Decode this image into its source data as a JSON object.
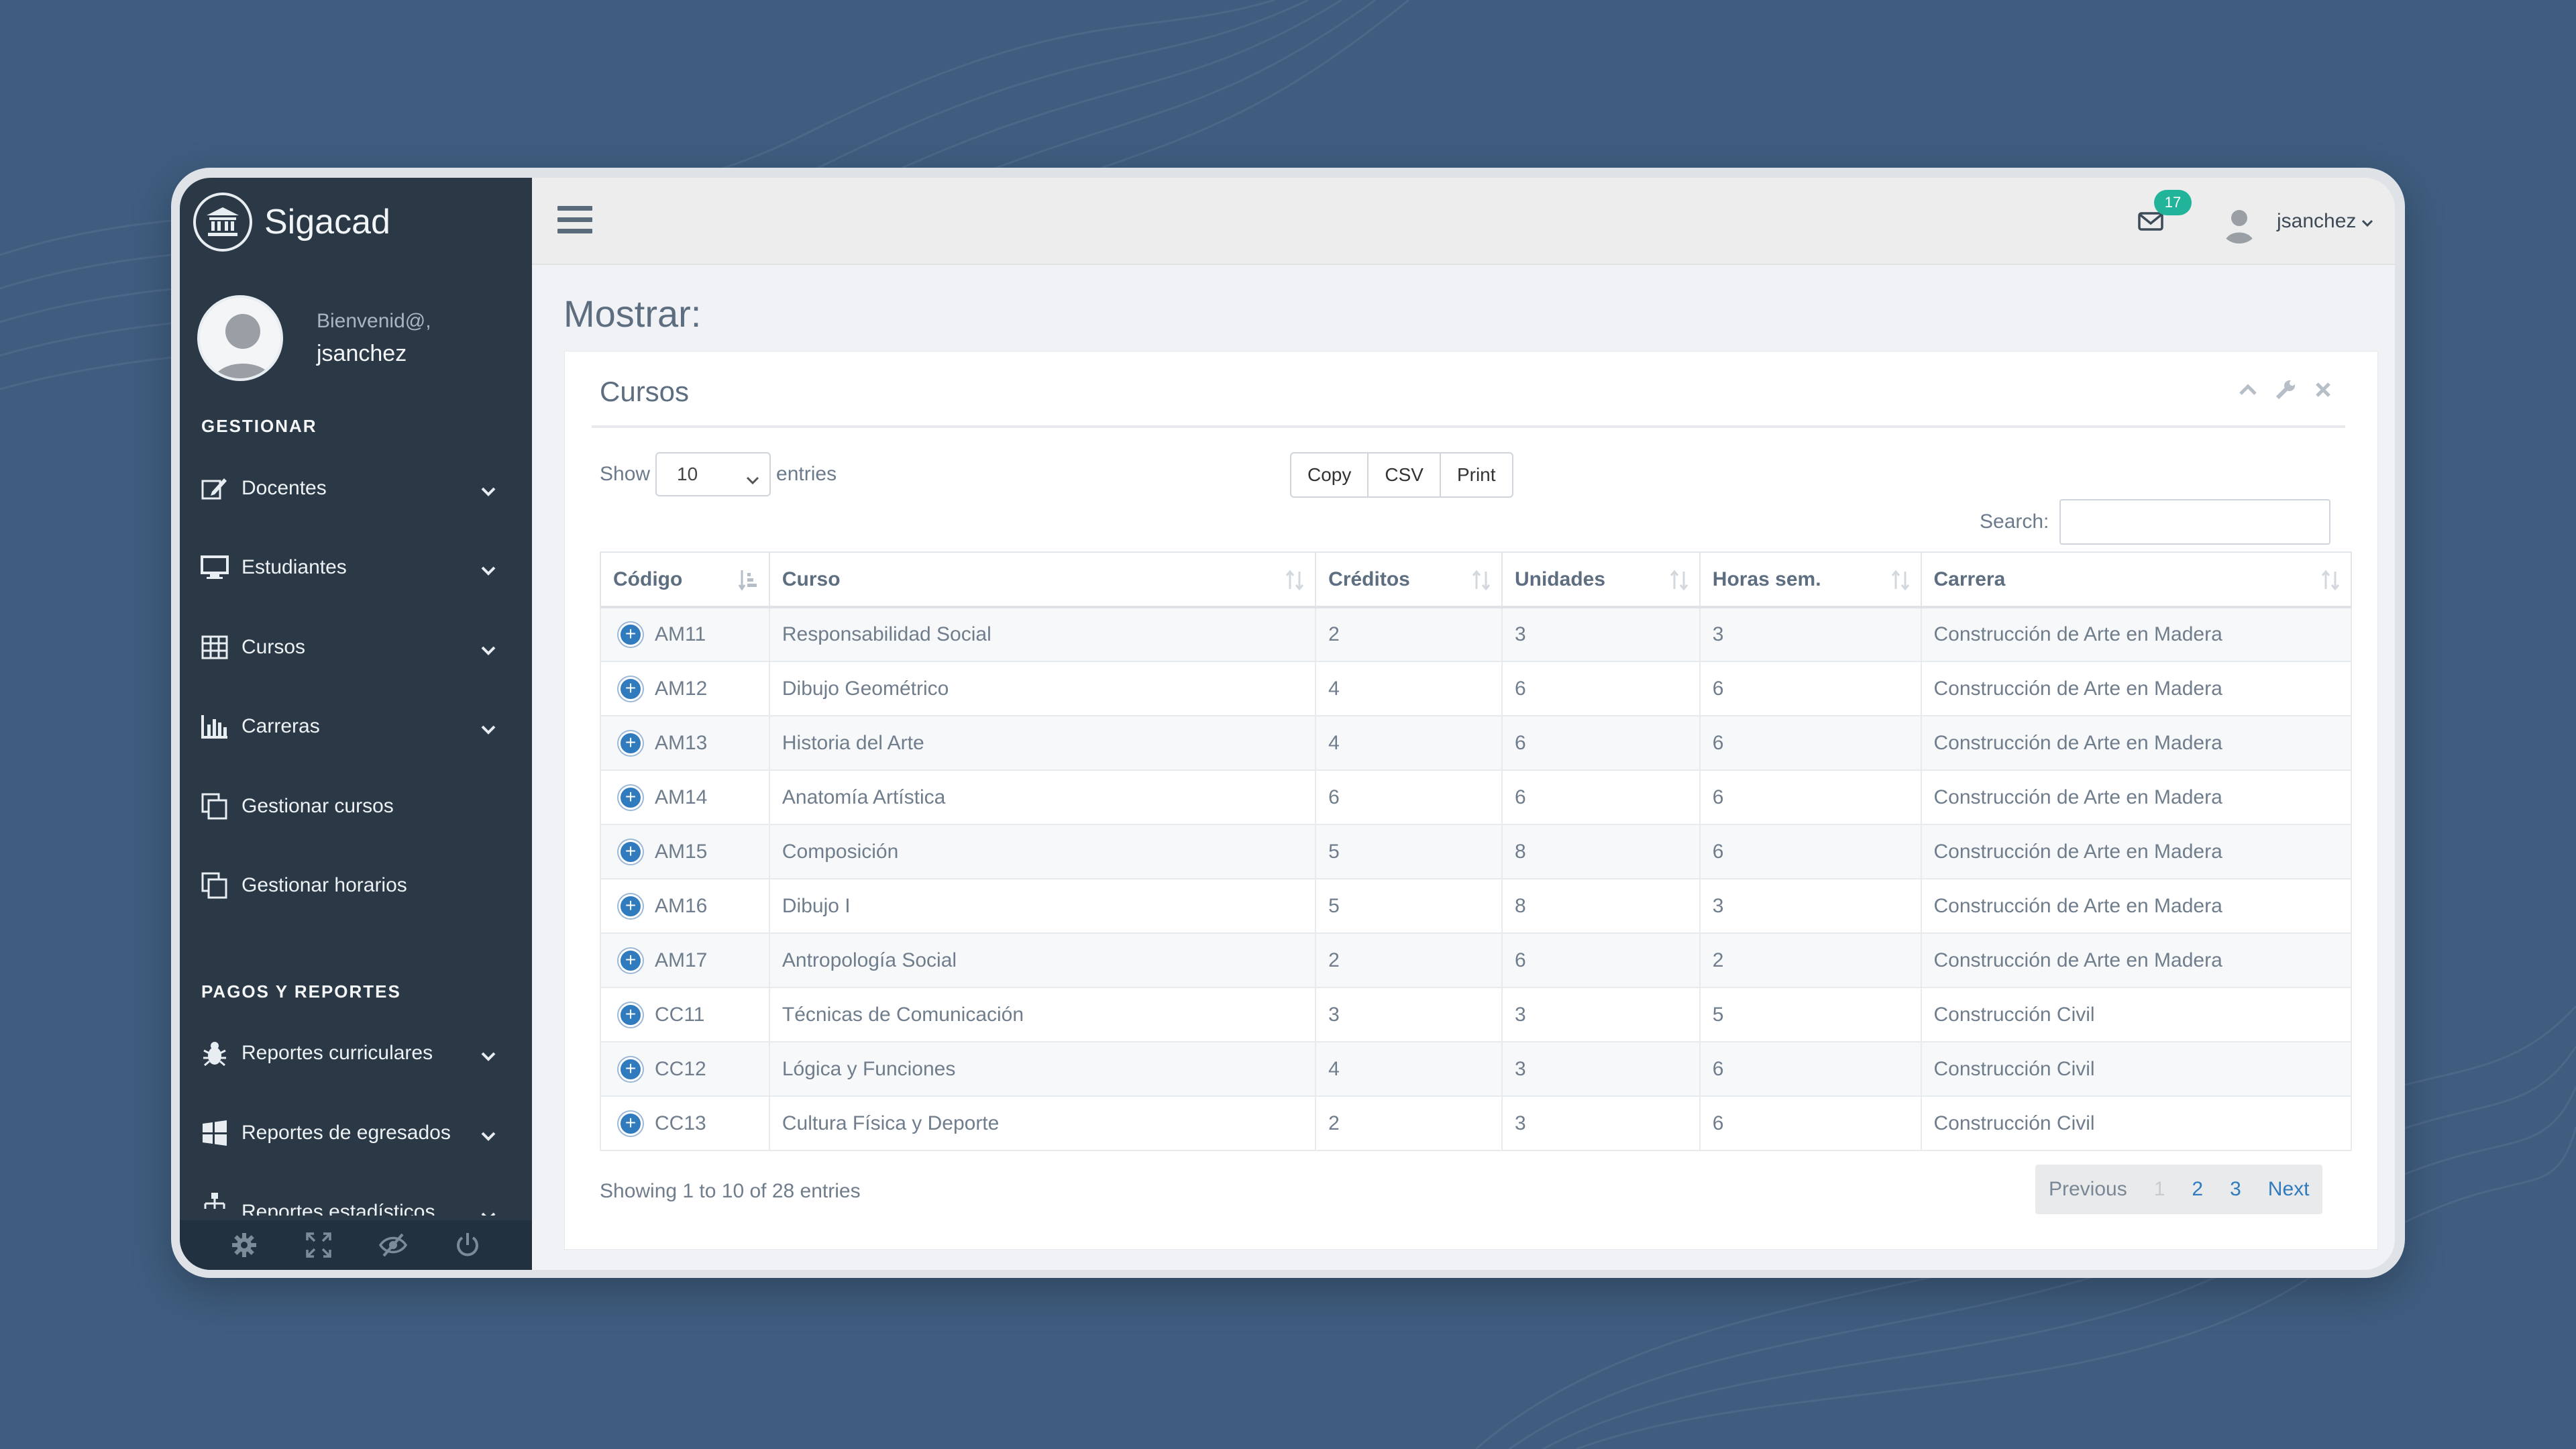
{
  "app": {
    "name": "Sigacad"
  },
  "profile": {
    "greeting": "Bienvenid@,",
    "username": "jsanchez"
  },
  "sidebar": {
    "section_manage": "GESTIONAR",
    "items": [
      {
        "label": "Docentes",
        "icon": "edit-icon"
      },
      {
        "label": "Estudiantes",
        "icon": "monitor-icon"
      },
      {
        "label": "Cursos",
        "icon": "table-icon"
      },
      {
        "label": "Carreras",
        "icon": "bar-chart-icon"
      },
      {
        "label": "Gestionar cursos",
        "icon": "copy-icon"
      },
      {
        "label": "Gestionar horarios",
        "icon": "copy-icon"
      }
    ],
    "section_reports": "PAGOS Y REPORTES",
    "report_items": [
      {
        "label": "Reportes curriculares",
        "icon": "bug-icon"
      },
      {
        "label": "Reportes de egresados",
        "icon": "windows-icon"
      },
      {
        "label": "Reportes estadísticos",
        "icon": "sitemap-icon"
      }
    ],
    "footer_icons": [
      "gear-icon",
      "fullscreen-icon",
      "eye-slash-icon",
      "power-icon"
    ]
  },
  "topbar": {
    "notifications": "17",
    "username": "jsanchez"
  },
  "page": {
    "title": "Mostrar:"
  },
  "panel": {
    "title": "Cursos",
    "show_label": "Show",
    "entries_value": "10",
    "entries_label": "entries",
    "buttons": [
      "Copy",
      "CSV",
      "Print"
    ],
    "search_label": "Search:",
    "search_value": ""
  },
  "table": {
    "columns": [
      "Código",
      "Curso",
      "Créditos",
      "Unidades",
      "Horas sem.",
      "Carrera"
    ],
    "rows": [
      [
        "AM11",
        "Responsabilidad Social",
        "2",
        "3",
        "3",
        "Construcción de Arte en Madera"
      ],
      [
        "AM12",
        "Dibujo Geométrico",
        "4",
        "6",
        "6",
        "Construcción de Arte en Madera"
      ],
      [
        "AM13",
        "Historia del Arte",
        "4",
        "6",
        "6",
        "Construcción de Arte en Madera"
      ],
      [
        "AM14",
        "Anatomía Artística",
        "6",
        "6",
        "6",
        "Construcción de Arte en Madera"
      ],
      [
        "AM15",
        "Composición",
        "5",
        "8",
        "6",
        "Construcción de Arte en Madera"
      ],
      [
        "AM16",
        "Dibujo I",
        "5",
        "8",
        "3",
        "Construcción de Arte en Madera"
      ],
      [
        "AM17",
        "Antropología Social",
        "2",
        "6",
        "2",
        "Construcción de Arte en Madera"
      ],
      [
        "CC11",
        "Técnicas de Comunicación",
        "3",
        "3",
        "5",
        "Construcción Civil"
      ],
      [
        "CC12",
        "Lógica y Funciones",
        "4",
        "3",
        "6",
        "Construcción Civil"
      ],
      [
        "CC13",
        "Cultura Física y Deporte",
        "2",
        "3",
        "6",
        "Construcción Civil"
      ]
    ]
  },
  "footer": {
    "info": "Showing 1 to 10 of 28 entries",
    "pagination": {
      "previous": "Previous",
      "pages": [
        "1",
        "2",
        "3"
      ],
      "next": "Next"
    }
  }
}
